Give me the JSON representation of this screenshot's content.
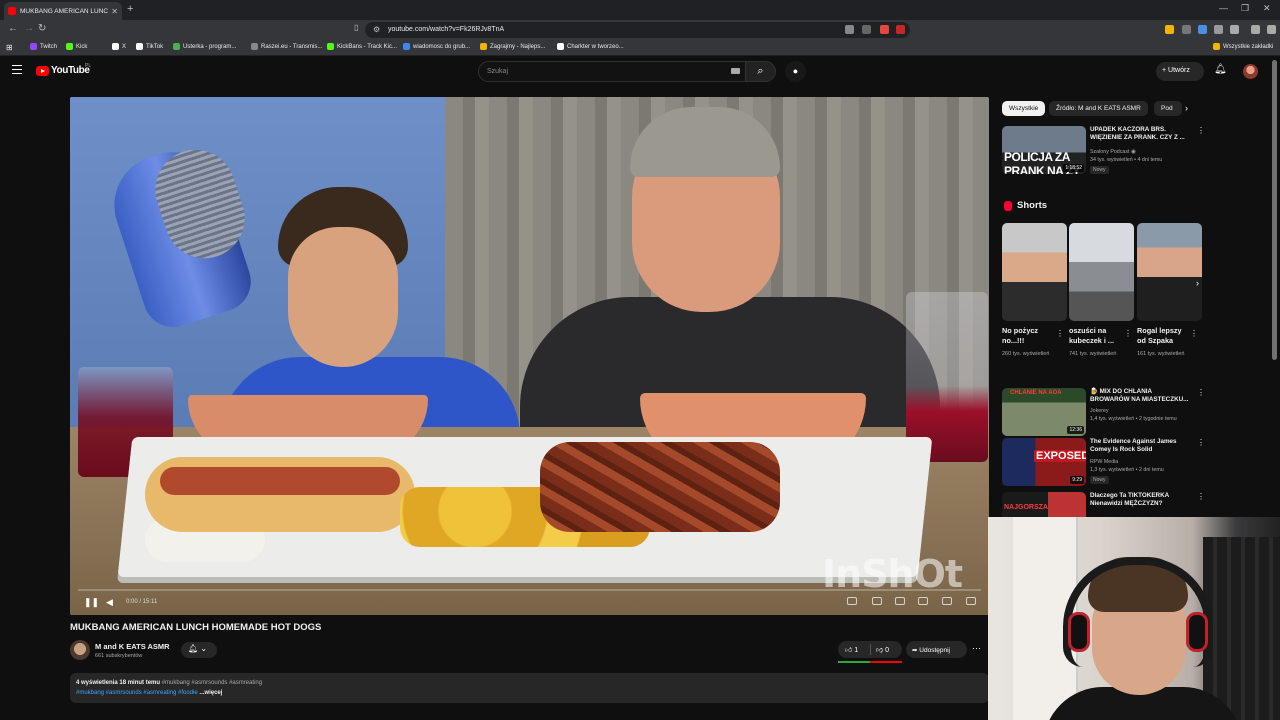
{
  "browser": {
    "tab_title": "MUKBANG AMERICAN LUNC",
    "url": "youtube.com/watch?v=Fk26RJv8TnA",
    "bookmarks": [
      {
        "label": "Twitch",
        "color": "#9146ff"
      },
      {
        "label": "Kick",
        "color": "#53fc18"
      },
      {
        "label": "X",
        "color": "#ffffff"
      },
      {
        "label": "TikTok",
        "color": "#ffffff"
      },
      {
        "label": "Usterka - program...",
        "color": "#4caf50"
      },
      {
        "label": "Raszei.eu - Transmis...",
        "color": "#888888"
      },
      {
        "label": "KickBans - Track Kic...",
        "color": "#53fc18"
      },
      {
        "label": "wiadomosc do grub...",
        "color": "#4285f4"
      },
      {
        "label": "Zagrajmy - Najleps...",
        "color": "#f4b400"
      },
      {
        "label": "Charkter w tworzeo...",
        "color": "#ffffff"
      }
    ],
    "all_bookmarks": "Wszystkie zakładki"
  },
  "header": {
    "logo_text": "YouTube",
    "country": "PL",
    "search_placeholder": "Szukaj",
    "create_label": "Utwórz"
  },
  "video": {
    "title": "MUKBANG AMERICAN LUNCH HOMEMADE HOT DOGS",
    "watermark": "InShOt",
    "time": "0:00 / 15:11",
    "progress": 0.0
  },
  "channel": {
    "name": "M and K EATS ASMR",
    "subscribers": "661 subskrybentów"
  },
  "actions": {
    "likes": "1",
    "dislikes": "0",
    "share": "Udostępnij"
  },
  "description": {
    "views": "4 wyświetlenia",
    "time": "18 minut temu",
    "tags_line1": "#mukbang #asmrsounds #asmreating",
    "tags_line2": "#mukbang #asmrsounds #asmreating #foodie",
    "more": "...więcej"
  },
  "sidebar": {
    "chips": [
      "Wszystkie",
      "Źródło: M and K EATS ASMR",
      "Pod"
    ],
    "top_video": {
      "title": "UPADEK KACZORA BRS. WIĘZIENIE ZA PRANK. CZY Z ...",
      "channel": "Szalony Podcast",
      "meta": "34 tys. wyświetleń • 4 dni temu",
      "badge": "Nowy",
      "duration": "1:18:52",
      "thumb_text": "POLICJA ZA PRANK NA ŻY"
    },
    "shorts_header": "Shorts",
    "shorts": [
      {
        "title": "No pożycz no...!!!",
        "views": "260 tys. wyświetleń"
      },
      {
        "title": "oszuści na kubeczek i ...",
        "views": "741 tys. wyświetleń"
      },
      {
        "title": "Rogal lepszy od Szpaka",
        "views": "161 tys. wyświetleń"
      }
    ],
    "videos": [
      {
        "title": "🍺 MIX DO CHLANIA BROWARÓW NA MIASTECZKU...",
        "channel": "Jokerey",
        "meta": "1,4 tys. wyświetleń • 2 tygodnie temu",
        "duration": "12:36",
        "thumb_text": "CHLANIE NA AOA"
      },
      {
        "title": "The Evidence Against James Comey Is Rock Solid",
        "channel": "RPW Media",
        "meta": "1,3 tys. wyświetleń • 2 dni temu",
        "badge": "Nowy",
        "duration": "9:29",
        "thumb_text": "EXPOSED!"
      },
      {
        "title": "Dlaczego Ta TIKTOKERKA Nienawidzi MĘŻCZYZN?",
        "channel": "",
        "meta": "",
        "duration": "",
        "thumb_text": "NAJGORSZA"
      }
    ]
  },
  "colors": {
    "accent": "#ff0000",
    "background": "#0f0f0f",
    "link": "#3ea6ff"
  }
}
